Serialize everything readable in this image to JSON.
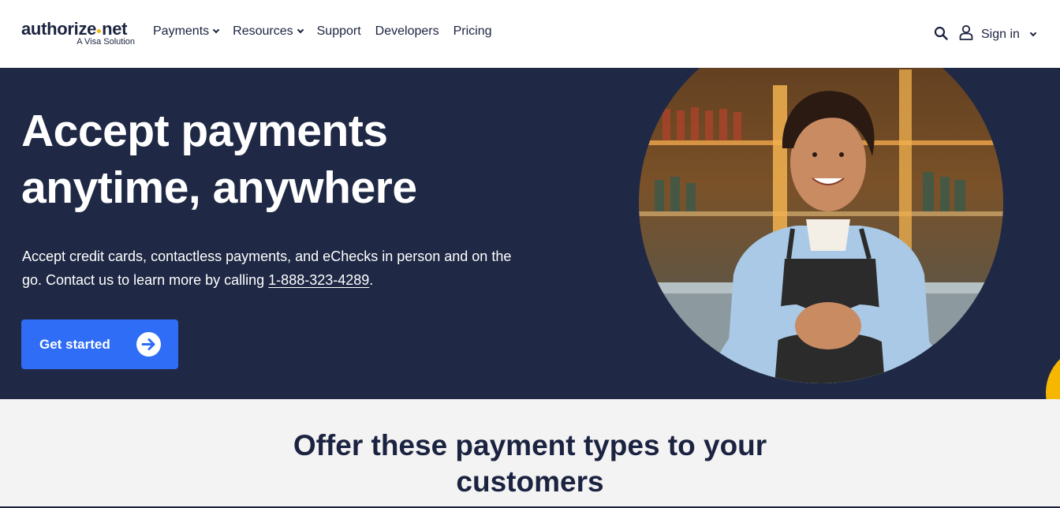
{
  "header": {
    "logo_text_before_dot": "authorize",
    "logo_text_after_dot": "net",
    "logo_subtitle": "A Visa Solution",
    "nav": [
      {
        "label": "Payments",
        "has_dropdown": true
      },
      {
        "label": "Resources",
        "has_dropdown": true
      },
      {
        "label": "Support",
        "has_dropdown": false
      },
      {
        "label": "Developers",
        "has_dropdown": false
      },
      {
        "label": "Pricing",
        "has_dropdown": false
      }
    ],
    "search_icon": "search-icon",
    "user_icon": "user-icon",
    "signin_label": "Sign in"
  },
  "hero": {
    "title_line1": "Accept payments",
    "title_line2": "anytime, anywhere",
    "text_part1": "Accept credit cards, contactless payments, and eChecks in person and on the go. Contact us to learn more by calling ",
    "phone": "1-888-323-4289",
    "text_part2": ".",
    "cta_label": "Get started",
    "cta_icon": "arrow-right-circle-icon"
  },
  "section": {
    "title_line1": "Offer these payment types to your",
    "title_line2": "customers"
  },
  "colors": {
    "navy": "#1f2945",
    "text_dark": "#1b2340",
    "cta_blue": "#2f6df6",
    "accent_yellow": "#f7b600",
    "section_bg": "#f3f3f3"
  }
}
